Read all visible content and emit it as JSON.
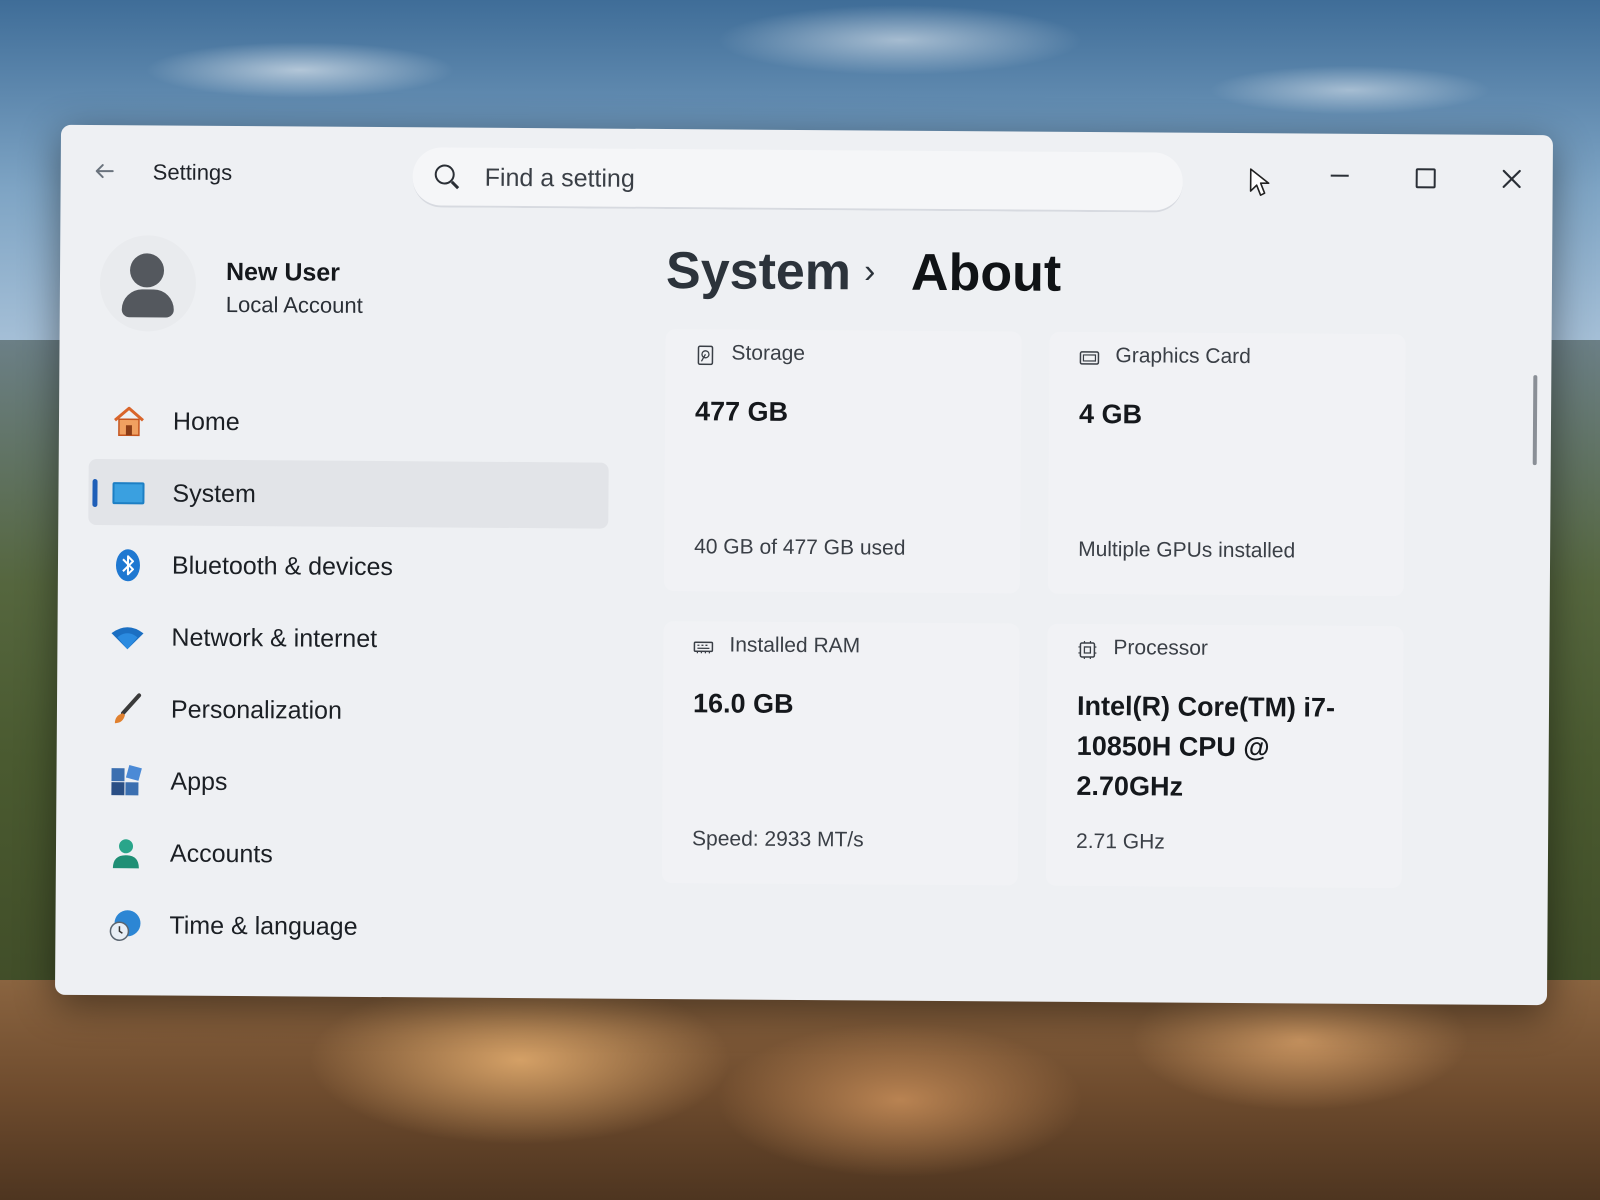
{
  "titlebar": {
    "app_title": "Settings",
    "search_placeholder": "Find a setting"
  },
  "profile": {
    "name": "New User",
    "account_type": "Local Account"
  },
  "sidebar": {
    "items": [
      {
        "label": "Home",
        "icon": "home-icon",
        "active": false
      },
      {
        "label": "System",
        "icon": "system-icon",
        "active": true
      },
      {
        "label": "Bluetooth & devices",
        "icon": "bluetooth-icon",
        "active": false
      },
      {
        "label": "Network & internet",
        "icon": "wifi-icon",
        "active": false
      },
      {
        "label": "Personalization",
        "icon": "brush-icon",
        "active": false
      },
      {
        "label": "Apps",
        "icon": "apps-icon",
        "active": false
      },
      {
        "label": "Accounts",
        "icon": "accounts-icon",
        "active": false
      },
      {
        "label": "Time & language",
        "icon": "clock-globe-icon",
        "active": false
      }
    ]
  },
  "breadcrumb": {
    "parent": "System",
    "separator": "›",
    "current": "About"
  },
  "cards": [
    {
      "title": "Storage",
      "icon": "hard-drive-icon",
      "value": "477 GB",
      "subtitle": "40 GB of 477 GB used"
    },
    {
      "title": "Graphics Card",
      "icon": "gpu-icon",
      "value": "4 GB",
      "subtitle": "Multiple GPUs installed"
    },
    {
      "title": "Installed RAM",
      "icon": "ram-icon",
      "value": "16.0 GB",
      "subtitle": "Speed: 2933 MT/s"
    },
    {
      "title": "Processor",
      "icon": "cpu-icon",
      "value": "Intel(R) Core(TM) i7-10850H CPU @ 2.70GHz",
      "subtitle": "2.71 GHz"
    }
  ],
  "colors": {
    "accent": "#1f5fb8",
    "window_bg": "#eef0f3",
    "card_bg": "#f1f2f5"
  }
}
